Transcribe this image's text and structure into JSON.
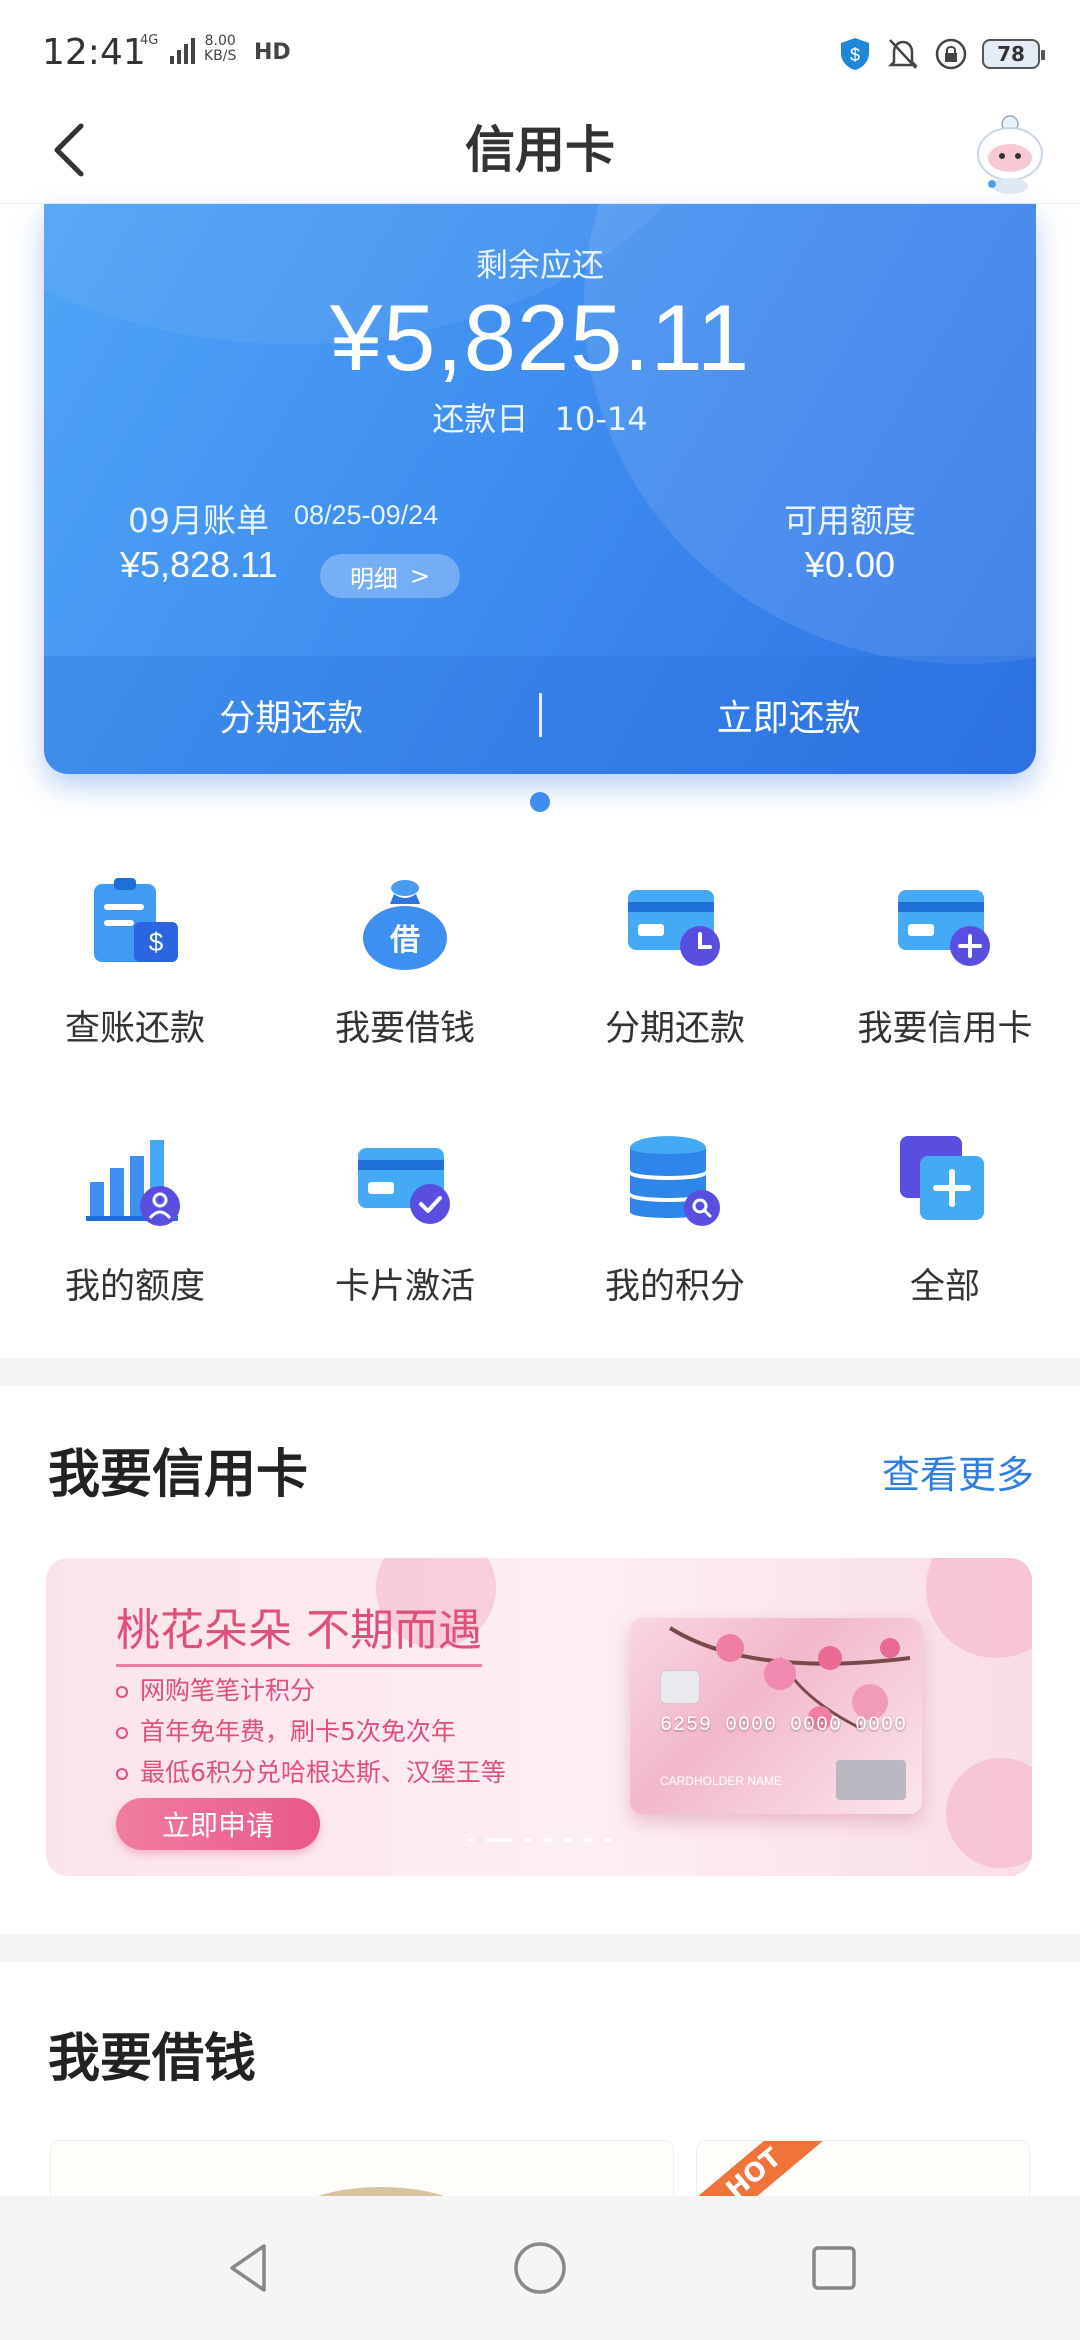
{
  "status_bar": {
    "time": "12:41",
    "network": "4G",
    "speed_value": "8.00",
    "speed_unit": "KB/S",
    "hd": "HD",
    "battery": "78"
  },
  "header": {
    "title": "信用卡"
  },
  "card": {
    "remaining_label": "剩余应还",
    "remaining_amount": "¥5,825.11",
    "due_label": "还款日",
    "due_date": "10-14",
    "bill_title": "09月账单",
    "bill_period": "08/25-09/24",
    "bill_amount": "¥5,828.11",
    "detail_label": "明细",
    "detail_arrow": ">",
    "available_label": "可用额度",
    "available_amount": "¥0.00",
    "action_installment": "分期还款",
    "action_repay_now": "立即还款"
  },
  "grid": [
    {
      "label": "查账还款",
      "icon": "bill-repay-icon"
    },
    {
      "label": "我要借钱",
      "icon": "money-bag-icon"
    },
    {
      "label": "分期还款",
      "icon": "card-clock-icon"
    },
    {
      "label": "我要信用卡",
      "icon": "card-add-icon"
    },
    {
      "label": "我的额度",
      "icon": "limit-chart-icon"
    },
    {
      "label": "卡片激活",
      "icon": "card-check-icon"
    },
    {
      "label": "我的积分",
      "icon": "points-database-icon"
    },
    {
      "label": "全部",
      "icon": "all-plus-icon"
    }
  ],
  "credit_section": {
    "title": "我要信用卡",
    "see_more": "查看更多"
  },
  "banner": {
    "title": "桃花朵朵 不期而遇",
    "bullets": [
      "网购笔笔计积分",
      "首年免年费，刷卡5次免次年",
      "最低6积分兑哈根达斯、汉堡王等"
    ],
    "apply_label": "立即申请",
    "card_number": "6259 0000 0000 0000",
    "card_holder": "CARDHOLDER NAME"
  },
  "loan_section": {
    "title": "我要借钱",
    "hot_badge": "HOT"
  },
  "colors": {
    "accent": "#2f7fe0",
    "card_blue": "#3f8ef0",
    "pink": "#e0507b"
  }
}
